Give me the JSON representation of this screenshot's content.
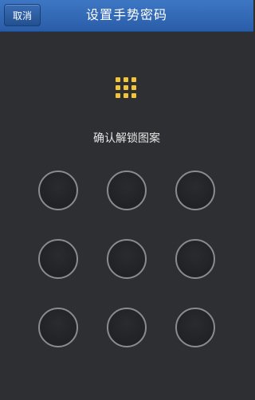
{
  "header": {
    "title": "设置手势密码",
    "cancel_label": "取消",
    "bar_color": "#2f64ad"
  },
  "lock_icon": {
    "name": "grid-icon",
    "color": "#f2c438"
  },
  "prompt": {
    "text": "确认解锁图案"
  },
  "pattern_grid": {
    "rows": 3,
    "cols": 3,
    "node_count": 9
  }
}
